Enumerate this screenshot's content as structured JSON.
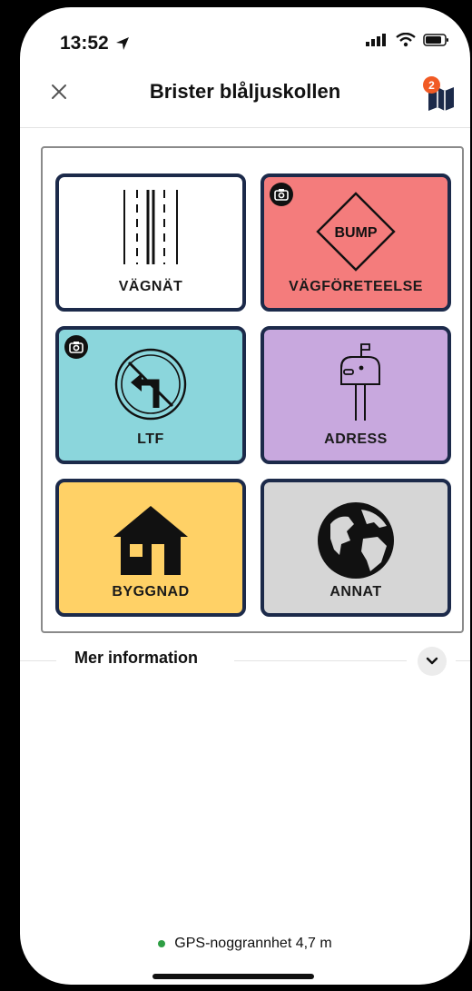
{
  "status": {
    "time": "13:52"
  },
  "header": {
    "title": "Brister blåljuskollen",
    "badge_count": "2"
  },
  "tiles": [
    {
      "label": "VÄGNÄT",
      "color": "#ffffff",
      "icon": "road-lanes-icon",
      "camera": false
    },
    {
      "label": "VÄGFÖRETEELSE",
      "color": "#f47c7c",
      "icon": "bump-sign-icon",
      "camera": true,
      "sign_text": "BUMP"
    },
    {
      "label": "LTF",
      "color": "#8bd6dc",
      "icon": "no-left-turn-icon",
      "camera": true
    },
    {
      "label": "ADRESS",
      "color": "#c8a8de",
      "icon": "mailbox-icon",
      "camera": false
    },
    {
      "label": "BYGGNAD",
      "color": "#ffd166",
      "icon": "house-icon",
      "camera": false
    },
    {
      "label": "ANNAT",
      "color": "#d6d6d6",
      "icon": "globe-icon",
      "camera": false
    }
  ],
  "more": {
    "label": "Mer information"
  },
  "gps": {
    "text": "GPS-noggrannhet 4,7 m",
    "status_color": "#2e9e44"
  }
}
